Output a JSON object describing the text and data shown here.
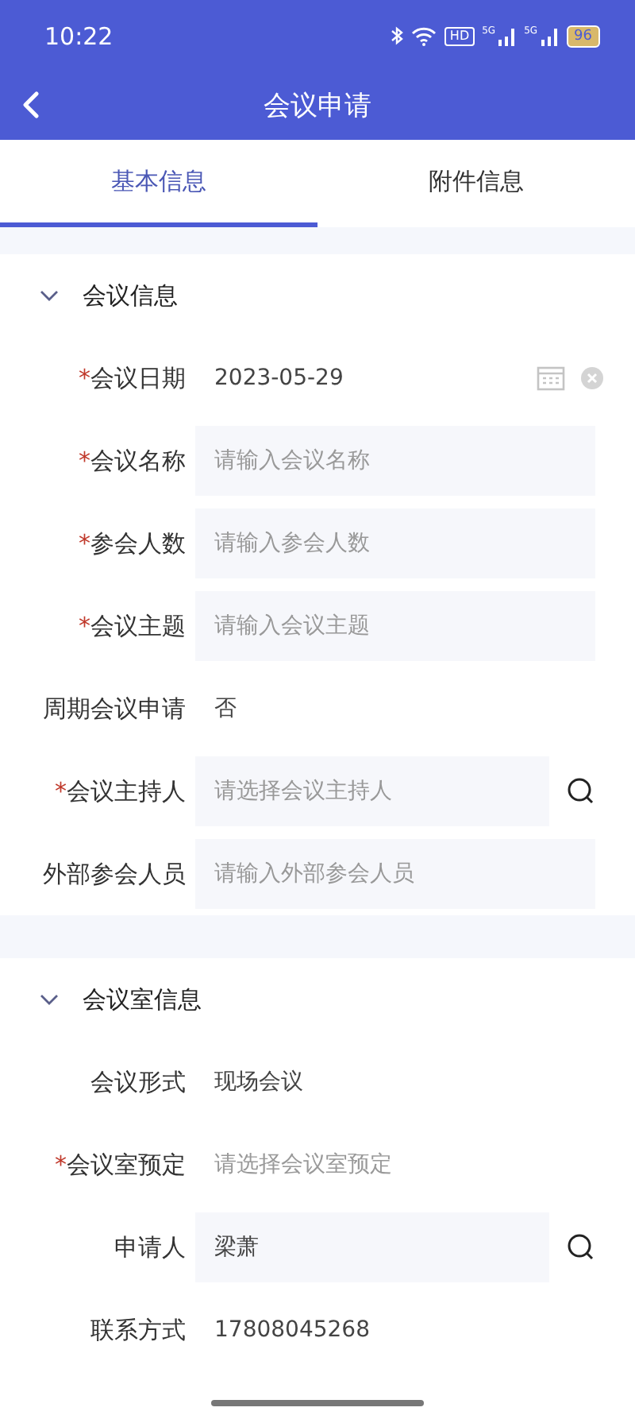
{
  "status_bar": {
    "time": "10:22",
    "hd": "HD",
    "network": [
      "5G",
      "5G"
    ],
    "battery": "96"
  },
  "nav_bar": {
    "title": "会议申请"
  },
  "tabs": [
    {
      "label": "基本信息",
      "selected": true
    },
    {
      "label": "附件信息",
      "selected": false
    }
  ],
  "sections": [
    {
      "title": "会议信息",
      "expanded": true,
      "rows": [
        {
          "kind": "date",
          "required_mark": "*",
          "label": "会议日期",
          "value": "2023-05-29"
        },
        {
          "kind": "input",
          "required_mark": "*",
          "label": "会议名称",
          "placeholder": "请输入会议名称"
        },
        {
          "kind": "input",
          "required_mark": "*",
          "label": "参会人数",
          "placeholder": "请输入参会人数"
        },
        {
          "kind": "input",
          "required_mark": "*",
          "label": "会议主题",
          "placeholder": "请输入会议主题"
        },
        {
          "kind": "text",
          "label": "周期会议申请",
          "value": "否"
        },
        {
          "kind": "search",
          "required_mark": "*",
          "label": "会议主持人",
          "placeholder": "请选择会议主持人"
        },
        {
          "kind": "input",
          "label": "外部参会人员",
          "placeholder": "请输入外部参会人员"
        }
      ]
    },
    {
      "title": "会议室信息",
      "expanded": true,
      "rows": [
        {
          "kind": "text",
          "label": "会议形式",
          "value": "现场会议"
        },
        {
          "kind": "select",
          "required_mark": "*",
          "label": "会议室预定",
          "placeholder": "请选择会议室预定"
        },
        {
          "kind": "search",
          "label": "申请人",
          "value": "梁萧"
        },
        {
          "kind": "text",
          "label": "联系方式",
          "value": "17808045268"
        }
      ]
    }
  ]
}
